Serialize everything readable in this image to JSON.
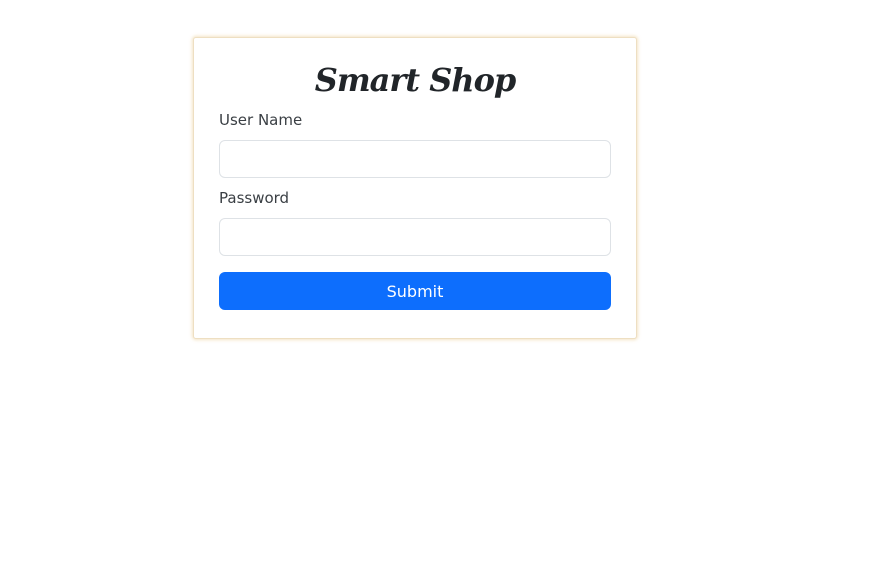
{
  "form": {
    "title": "Smart Shop",
    "username_label": "User Name",
    "username_value": "",
    "password_label": "Password",
    "password_value": "",
    "submit_label": "Submit"
  },
  "colors": {
    "primary": "#0d6efd",
    "card_border": "#eedfc2",
    "input_border": "#dee2e6",
    "text": "#212529"
  }
}
